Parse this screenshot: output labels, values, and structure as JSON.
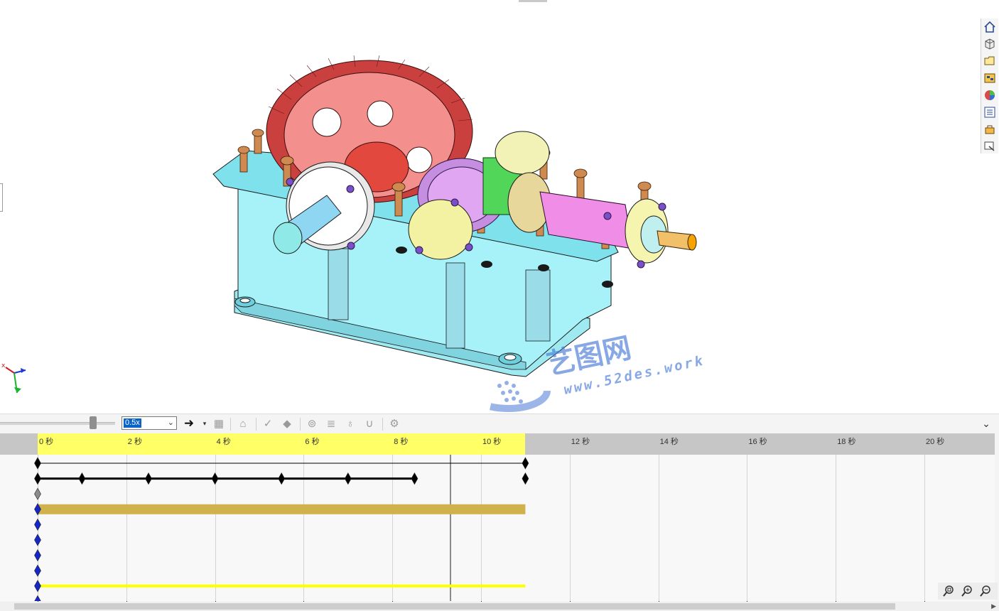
{
  "viewport": {
    "watermark": {
      "brand": "艺图网",
      "url": "www.52des.work"
    },
    "triad_labels": {
      "x": "x"
    }
  },
  "taskpane": {
    "items": [
      {
        "name": "home-icon"
      },
      {
        "name": "parts-library-icon"
      },
      {
        "name": "file-explorer-icon"
      },
      {
        "name": "view-palette-icon"
      },
      {
        "name": "appearances-icon"
      },
      {
        "name": "custom-properties-icon"
      },
      {
        "name": "design-library-icon"
      },
      {
        "name": "forum-icon"
      }
    ]
  },
  "toolbar": {
    "playback_speed": "0.5x",
    "playback_mode_icon": "arrow-right-icon"
  },
  "timeline": {
    "ruler_ticks": [
      {
        "label": "0 秒",
        "seconds": 0
      },
      {
        "label": "2 秒",
        "seconds": 2
      },
      {
        "label": "4 秒",
        "seconds": 4
      },
      {
        "label": "6 秒",
        "seconds": 6
      },
      {
        "label": "8 秒",
        "seconds": 8
      },
      {
        "label": "10 秒",
        "seconds": 10
      },
      {
        "label": "12 秒",
        "seconds": 12
      },
      {
        "label": "14 秒",
        "seconds": 14
      },
      {
        "label": "16 秒",
        "seconds": 16
      },
      {
        "label": "18 秒",
        "seconds": 18
      },
      {
        "label": "20 秒",
        "seconds": 20
      }
    ],
    "animation_end_seconds": 11,
    "playhead_seconds": 9.3,
    "tracks": [
      {
        "type": "line",
        "color": "#000000",
        "thin": true,
        "start": 0,
        "end": 11,
        "keys": [
          0,
          11
        ],
        "key_color": "#000000"
      },
      {
        "type": "line",
        "color": "#000000",
        "thin": false,
        "start": 0,
        "end": 8.5,
        "keys": [
          0,
          1,
          2.5,
          4,
          5.5,
          7,
          8.5,
          11
        ],
        "key_color": "#000000"
      },
      {
        "type": "none",
        "keys": [
          0
        ],
        "key_color": "#8c8c8c"
      },
      {
        "type": "bar",
        "color": "#d1b14c",
        "start": 0,
        "end": 11,
        "keys": [
          0
        ],
        "key_color": "#1428c8"
      },
      {
        "type": "none",
        "keys": [
          0
        ],
        "key_color": "#1428c8"
      },
      {
        "type": "none",
        "keys": [
          0
        ],
        "key_color": "#1428c8"
      },
      {
        "type": "none",
        "keys": [
          0
        ],
        "key_color": "#1428c8"
      },
      {
        "type": "none",
        "keys": [
          0
        ],
        "key_color": "#1428c8"
      },
      {
        "type": "thinbar",
        "color": "#ffff00",
        "start": 0,
        "end": 11,
        "keys": [
          0
        ],
        "key_color": "#1428c8"
      },
      {
        "type": "none",
        "keys": [
          0
        ],
        "key_color": "#1428c8"
      }
    ]
  }
}
